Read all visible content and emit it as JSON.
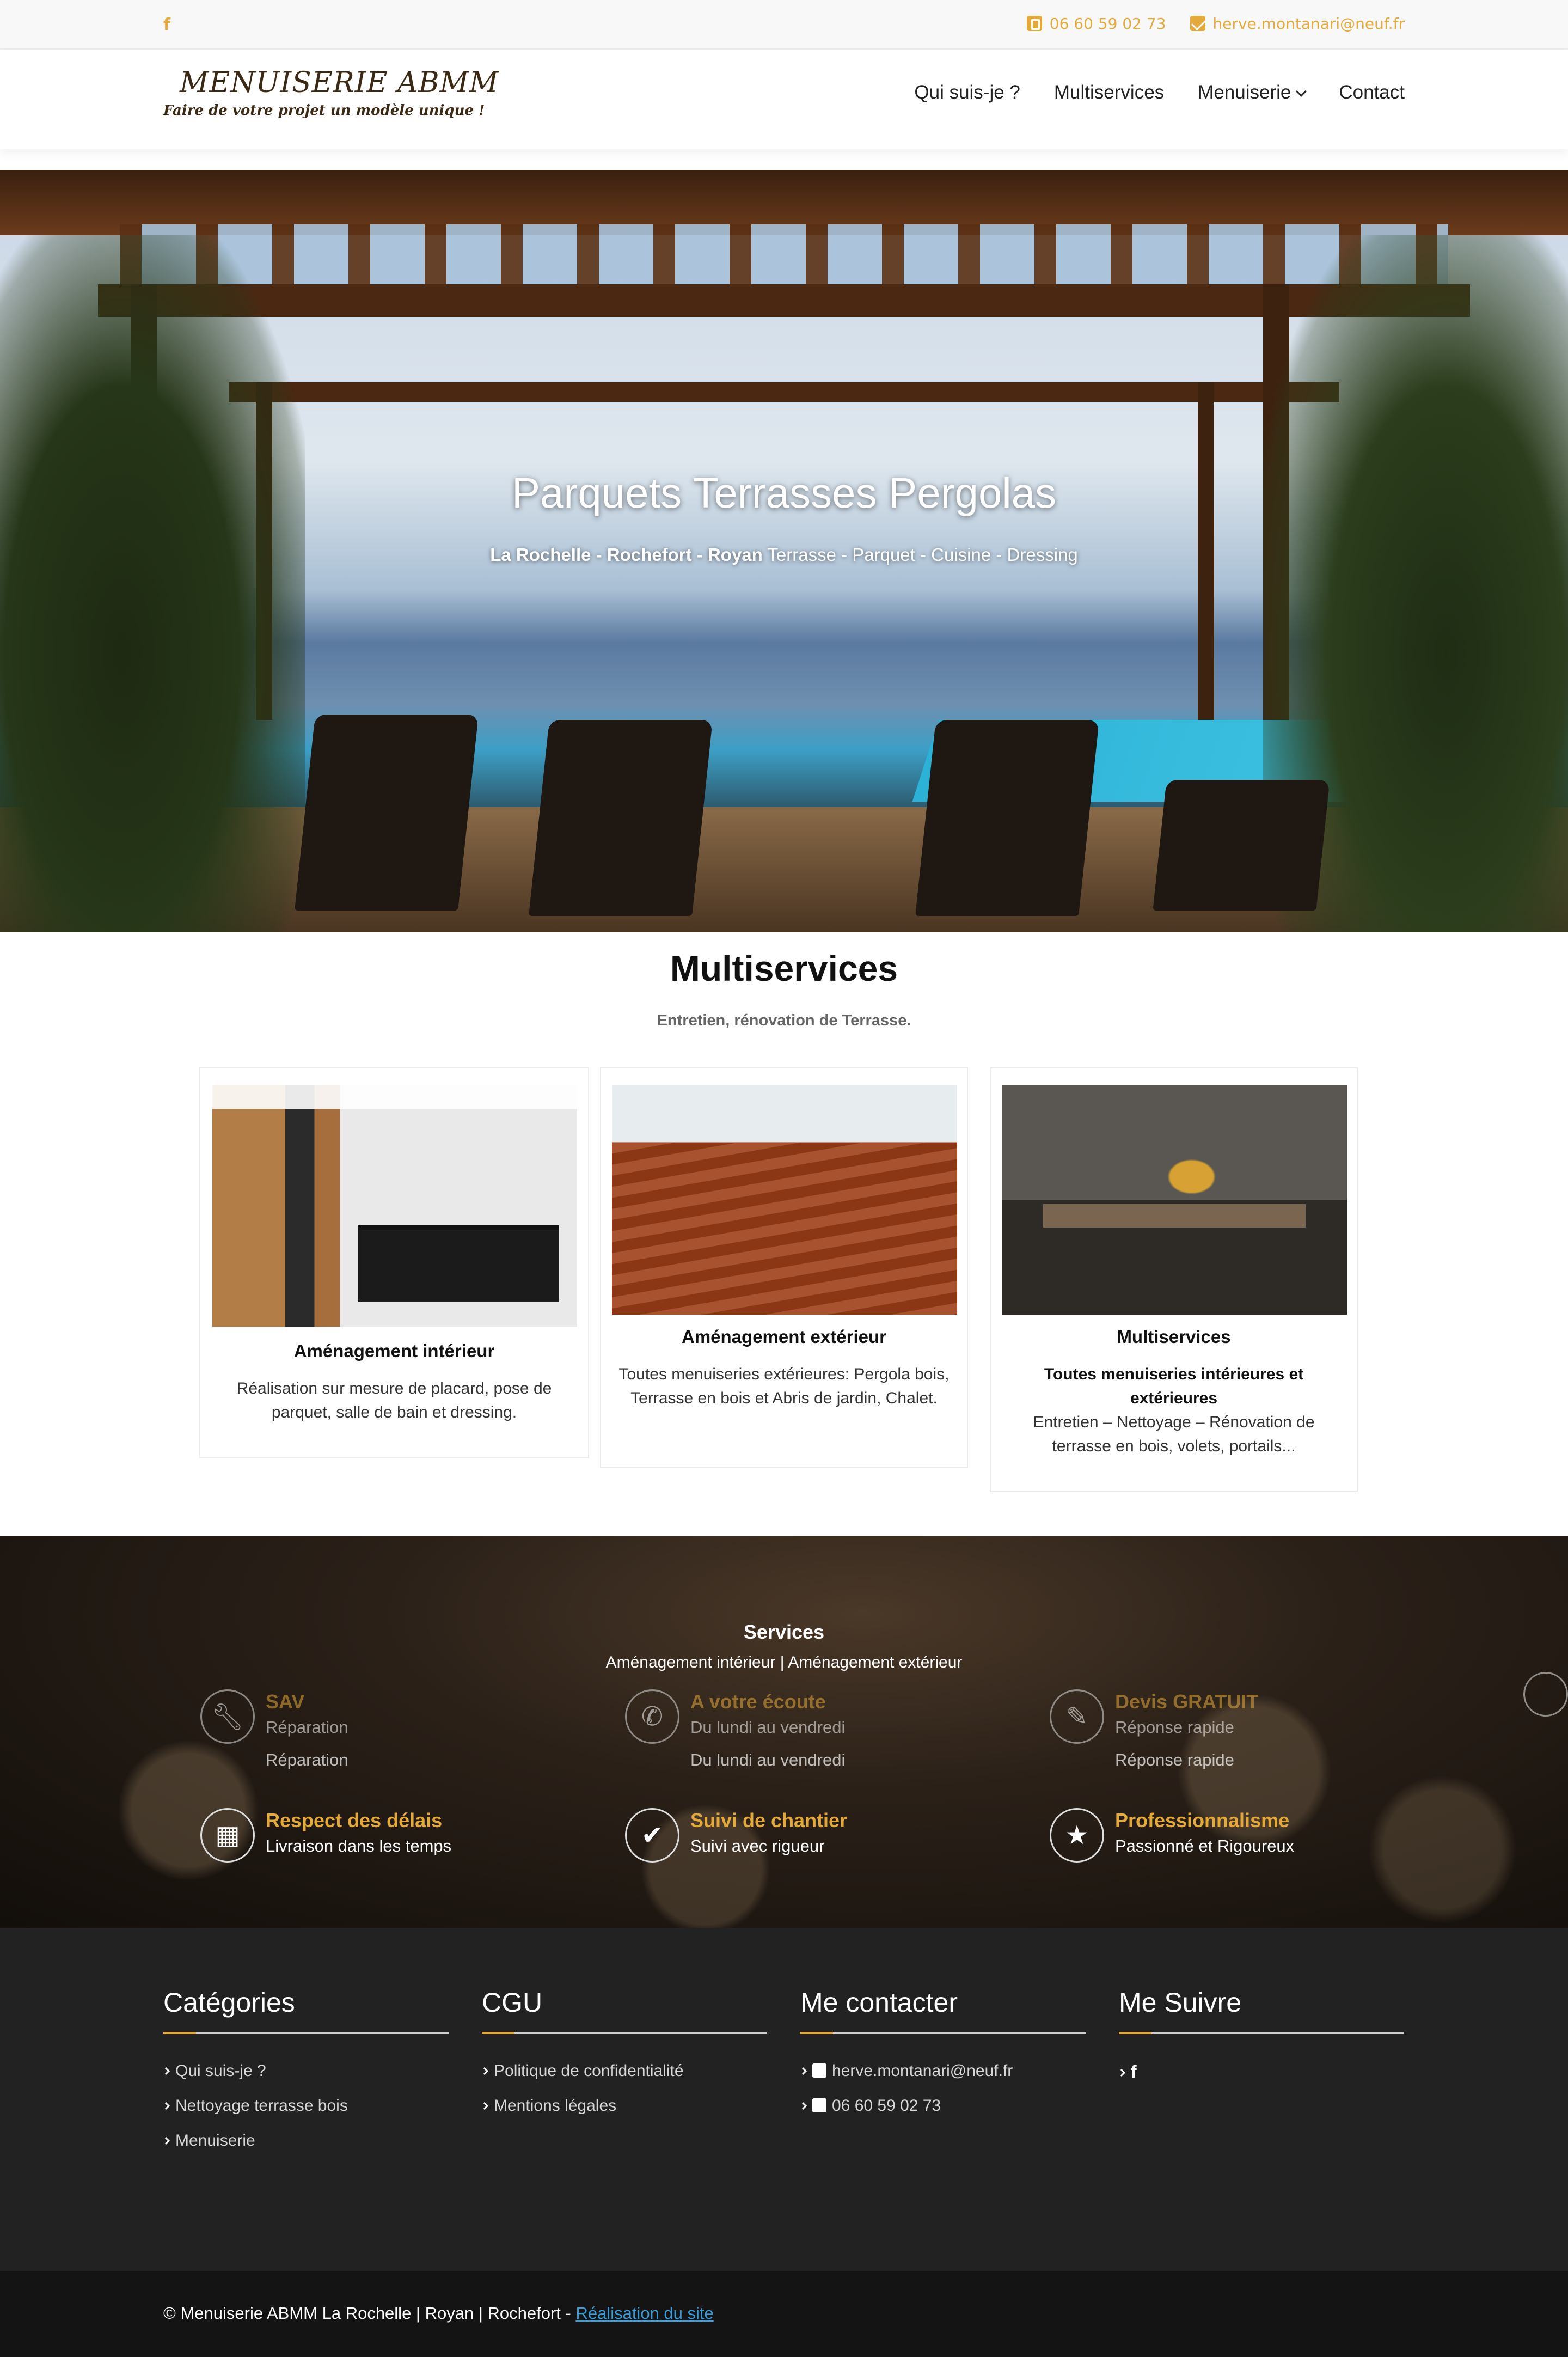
{
  "topbar": {
    "facebook_icon": "f",
    "phone": "06 60 59 02 73",
    "email": "herve.montanari@neuf.fr"
  },
  "header": {
    "logo_title": "MENUISERIE ABMM",
    "logo_tagline": "Faire de votre projet un modèle unique !",
    "nav": [
      "Qui suis-je ?",
      "Multiservices",
      "Menuiserie",
      "Contact"
    ]
  },
  "hero": {
    "title": "Parquets Terrasses Pergolas",
    "subtitle_bold": "La Rochelle - Rochefort - Royan",
    "subtitle_rest": " Terrasse - Parquet - Cuisine - Dressing"
  },
  "multiservices": {
    "title": "Multiservices",
    "subtitle": "Entretien, rénovation de Terrasse.",
    "cards": [
      {
        "title": "Aménagement intérieur",
        "bold": "",
        "text": "Réalisation sur mesure de placard, pose de parquet, salle de bain et dressing."
      },
      {
        "title": "Aménagement extérieur",
        "bold": "",
        "text": "Toutes menuiseries extérieures: Pergola bois, Terrasse en bois et Abris de jardin, Chalet."
      },
      {
        "title": "Multiservices",
        "bold": "Toutes menuiseries intérieures et extérieures",
        "text": "Entretien – Nettoyage – Rénovation de terrasse en bois, volets, portails..."
      }
    ]
  },
  "services": {
    "title": "Services",
    "subtitle": "Aménagement intérieur | Aménagement extérieur",
    "row1": [
      {
        "title": "SAV",
        "sub": "Réparation",
        "icon": "wrench-icon"
      },
      {
        "title": "A votre écoute",
        "sub": "Du lundi au vendredi",
        "icon": "phone-icon"
      },
      {
        "title": "Devis GRATUIT",
        "sub": "Réponse rapide",
        "icon": "edit-icon"
      }
    ],
    "row2": [
      {
        "title": "Respect des délais",
        "sub": "Livraison dans les temps",
        "icon": "calendar-icon"
      },
      {
        "title": "Suivi de chantier",
        "sub": "Suivi avec rigueur",
        "icon": "check-icon"
      },
      {
        "title": "Professionnalisme",
        "sub": "Passionné et Rigoureux",
        "icon": "star-icon"
      }
    ]
  },
  "footer": {
    "categories": {
      "title": "Catégories",
      "items": [
        "Qui suis-je ?",
        "Nettoyage terrasse bois",
        "Menuiserie"
      ]
    },
    "cgu": {
      "title": "CGU",
      "items": [
        "Politique de confidentialité",
        "Mentions légales"
      ]
    },
    "contact": {
      "title": "Me contacter",
      "email": "herve.montanari@neuf.fr",
      "phone": "06 60 59 02 73"
    },
    "follow": {
      "title": "Me Suivre",
      "facebook": "f"
    }
  },
  "bottombar": {
    "copyright": "© Menuiserie ABMM La Rochelle | Royan | Rochefort - ",
    "link": "Réalisation du site"
  },
  "colors": {
    "accent": "#e3a93a",
    "footer_bg": "#222222",
    "bottombar_bg": "#141414",
    "link": "#3a9edb"
  }
}
